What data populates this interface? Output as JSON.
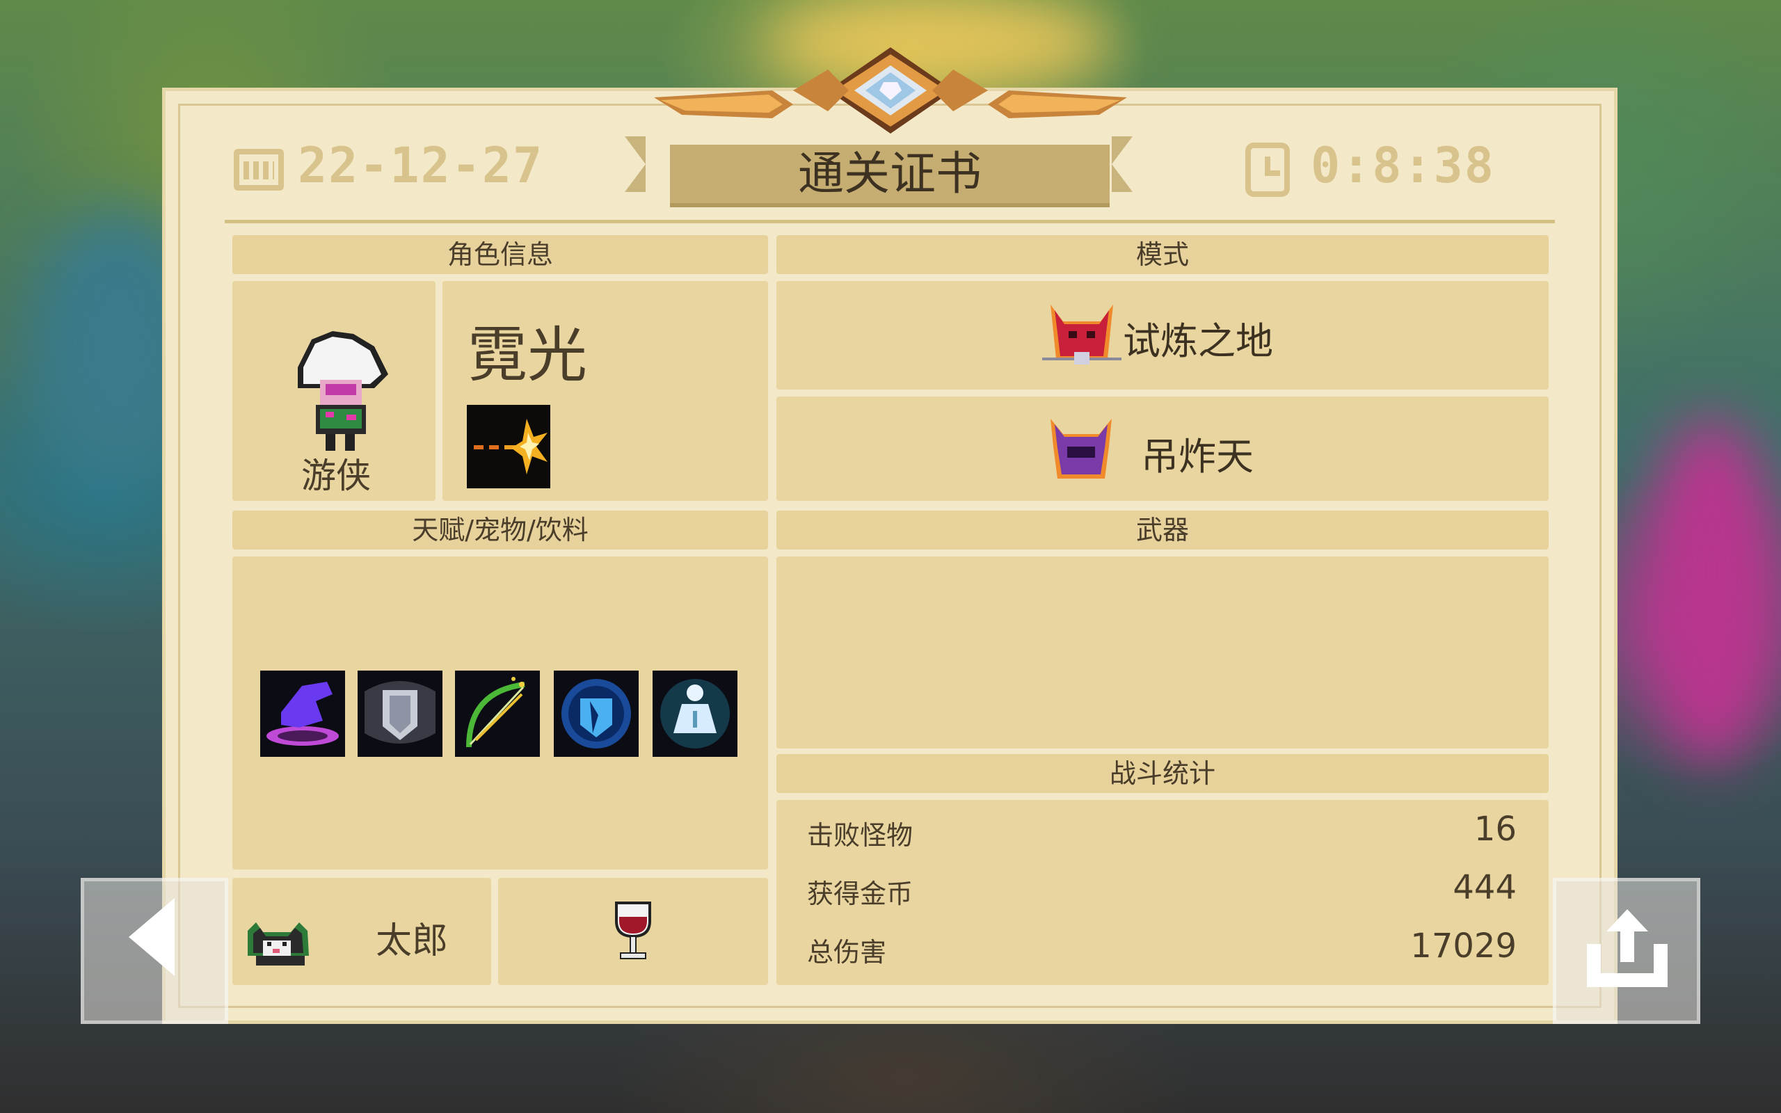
{
  "header": {
    "date": "22-12-27",
    "title": "通关证书",
    "time": "0:8:38"
  },
  "character": {
    "section_label": "角色信息",
    "name": "霓光",
    "class": "游侠"
  },
  "mode": {
    "section_label": "模式",
    "primary": "试炼之地",
    "secondary": "吊炸天"
  },
  "talents": {
    "section_label": "天赋/宠物/饮料",
    "icons": [
      "purple-hand-talent-icon",
      "shield-talent-icon",
      "bow-talent-icon",
      "blue-shield-talent-icon",
      "meditation-talent-icon"
    ]
  },
  "weapons": {
    "section_label": "武器"
  },
  "pet": {
    "name": "太郎"
  },
  "drink": {
    "icon": "wine-glass-icon"
  },
  "battle_stats": {
    "section_label": "战斗统计",
    "rows": [
      {
        "label": "击败怪物",
        "value": "16"
      },
      {
        "label": "获得金币",
        "value": "444"
      },
      {
        "label": "总伤害",
        "value": "17029"
      }
    ]
  },
  "colors": {
    "panel": "#f3e8c8",
    "section": "#e8d5a0",
    "title_banner": "#c6ae72",
    "header_text": "#d9c38c"
  }
}
